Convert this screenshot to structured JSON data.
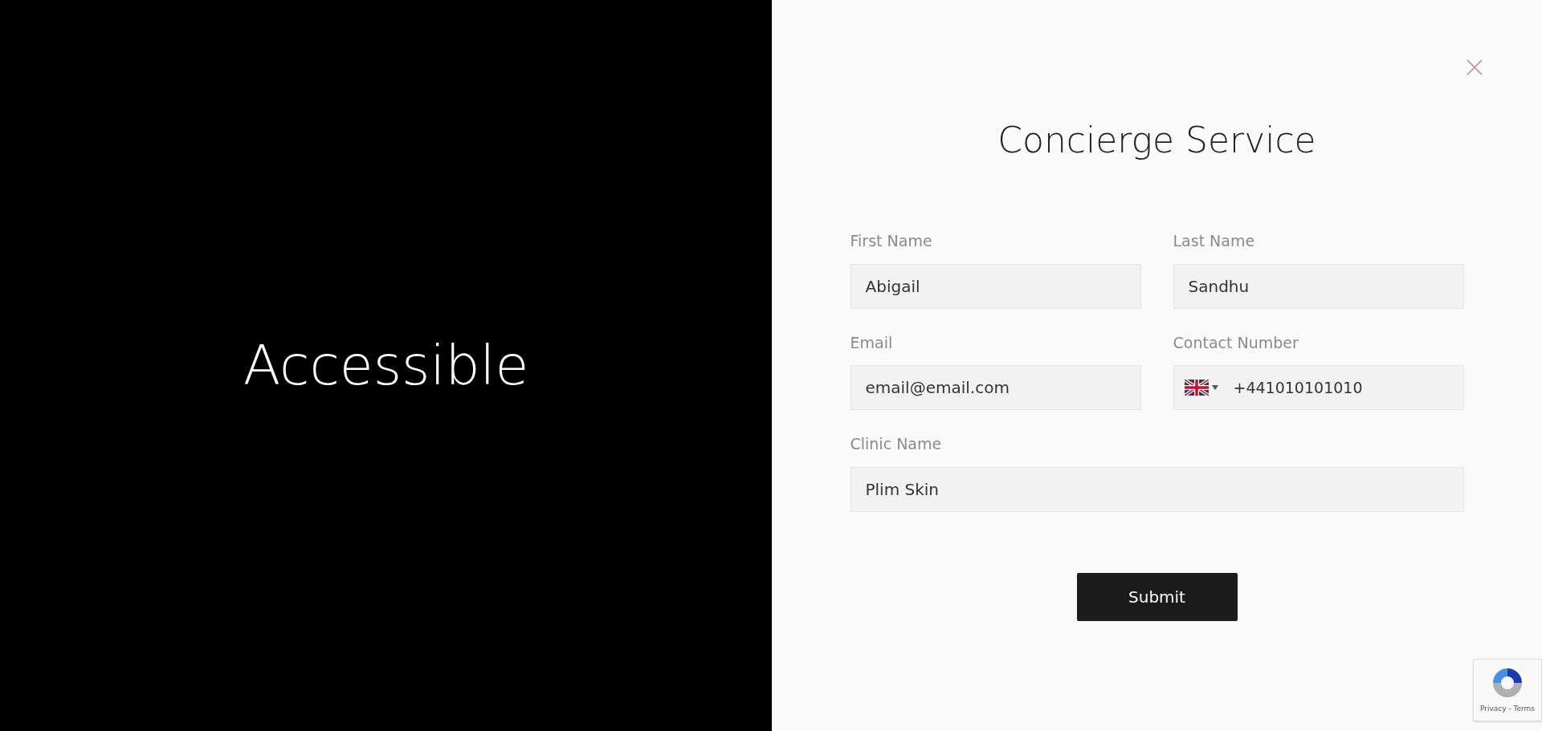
{
  "hero": {
    "text": "Accessible"
  },
  "dialog": {
    "title": "Concierge Service",
    "rows": [
      [
        {
          "kind": "text",
          "label": "First Name",
          "value": "Abigail"
        },
        {
          "kind": "text",
          "label": "Last Name",
          "value": "Sandhu"
        }
      ],
      [
        {
          "kind": "text",
          "label": "Email",
          "value": "email@email.com"
        },
        {
          "kind": "phone",
          "label": "Contact Number",
          "value": "+441010101010"
        }
      ],
      [
        {
          "kind": "text",
          "label": "Clinic Name",
          "value": "Plim Skin"
        }
      ]
    ],
    "submit": "Submit"
  },
  "recaptcha": {
    "links": "Privacy - Terms"
  }
}
